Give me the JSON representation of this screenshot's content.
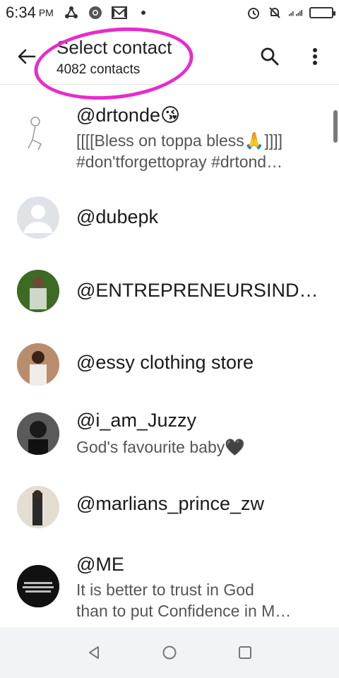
{
  "status_bar": {
    "time": "6:34",
    "ampm": "PM",
    "icons": [
      "navigation-icon",
      "chrome-icon",
      "mail-icon",
      "dot-icon",
      "alarm-icon",
      "mute-icon",
      "signal-icon",
      "battery-icon"
    ]
  },
  "header": {
    "title": "Select contact",
    "subtitle": "4082 contacts",
    "highlight_color": "#e62ccc"
  },
  "contacts": [
    {
      "name": "@drtonde😘",
      "status_lines": [
        "[[[[Bless on toppa bless🙏]]]]",
        "#don'tforgettopray #drtond…"
      ]
    },
    {
      "name": "@dubepk",
      "status_lines": []
    },
    {
      "name": "@ENTREPRENEURSIND…",
      "status_lines": []
    },
    {
      "name": "@essy clothing store",
      "status_lines": []
    },
    {
      "name": "@i_am_Juzzy",
      "status_lines": [
        "God's favourite baby🖤"
      ]
    },
    {
      "name": "@marlians_prince_zw",
      "status_lines": []
    },
    {
      "name": "@ME",
      "status_lines": [
        "It is better to trust in God",
        "than to put Confidence in M…"
      ]
    }
  ],
  "nav": {
    "back": "back-triangle-icon",
    "home": "home-circle-icon",
    "recents": "recents-square-icon"
  }
}
